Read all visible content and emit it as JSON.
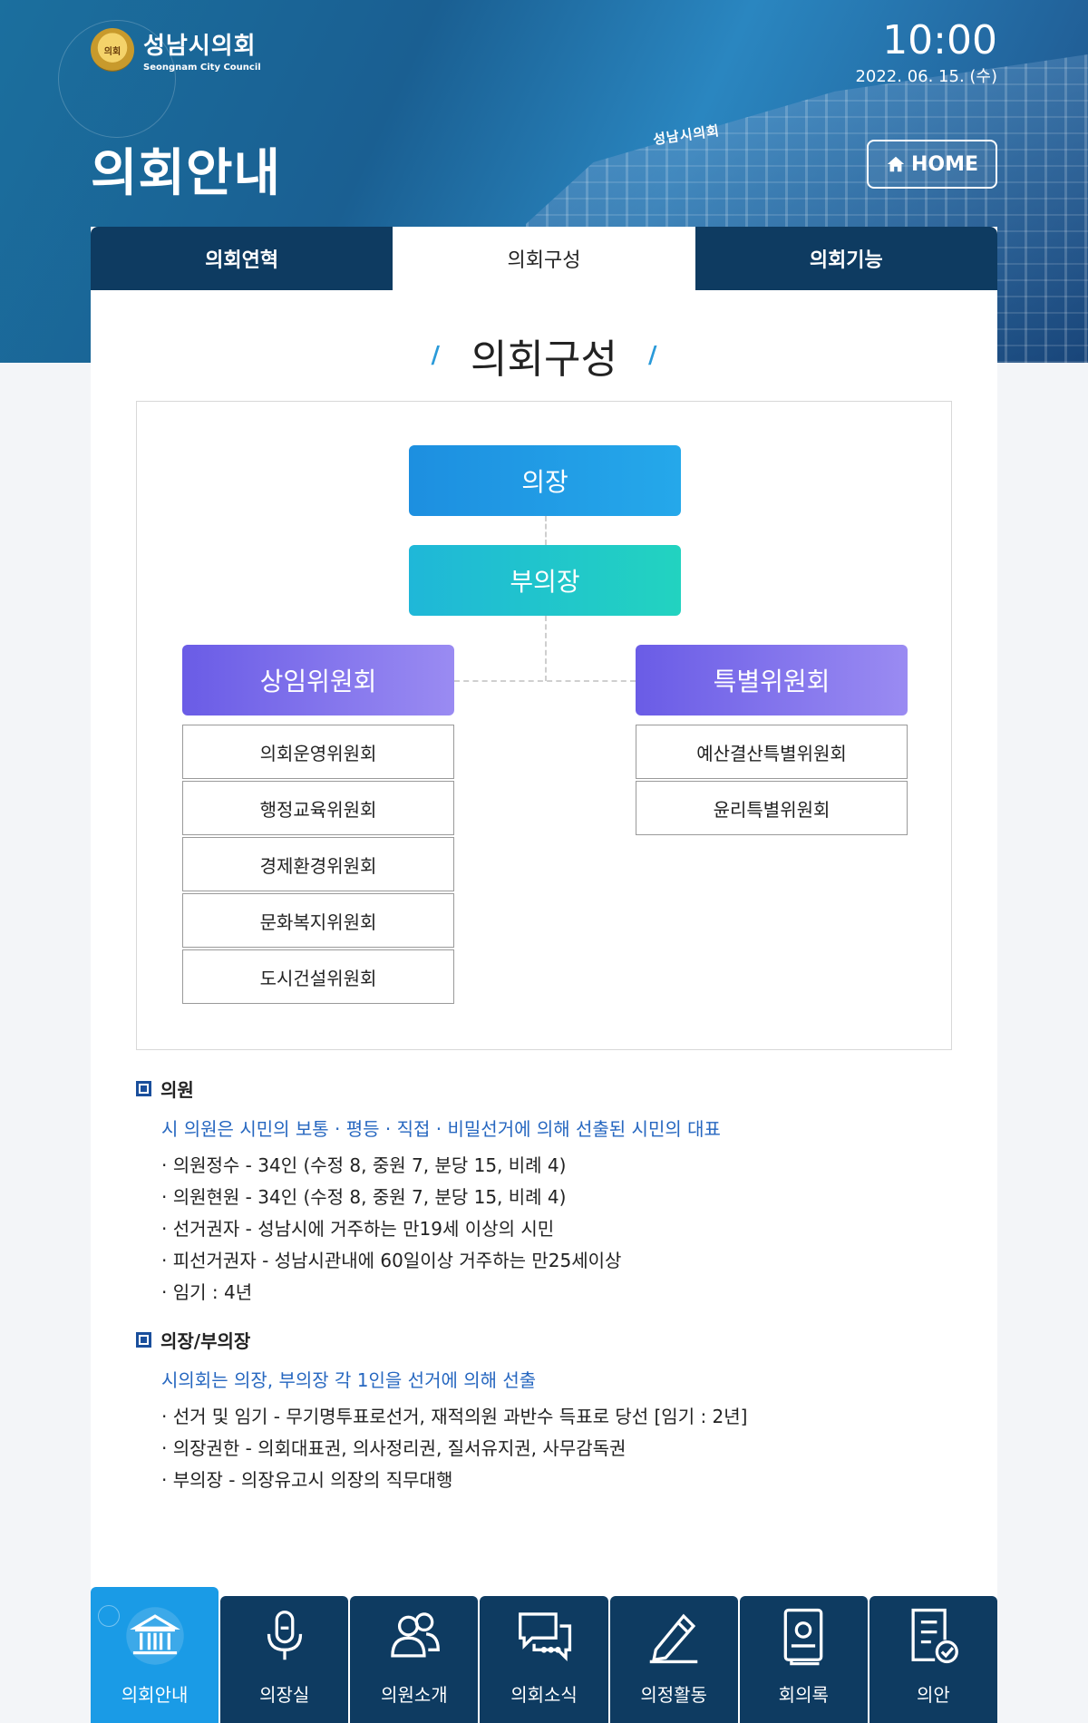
{
  "header": {
    "logo_ko": "성남시의회",
    "logo_en": "Seongnam City Council",
    "logo_mark": "의회",
    "building_sign": "성남시의회",
    "time": "10:00",
    "date": "2022. 06. 15. (수)",
    "page_title": "의회안내",
    "home_label": "HOME"
  },
  "tabs": [
    {
      "label": "의회연혁",
      "active": false
    },
    {
      "label": "의회구성",
      "active": true
    },
    {
      "label": "의회기능",
      "active": false
    }
  ],
  "section_title": "의회구성",
  "org": {
    "chair": "의장",
    "vice": "부의장",
    "standing": {
      "label": "상임위원회",
      "committees": [
        "의회운영위원회",
        "행정교육위원회",
        "경제환경위원회",
        "문화복지위원회",
        "도시건설위원회"
      ]
    },
    "special": {
      "label": "특별위원회",
      "committees": [
        "예산결산특별위원회",
        "윤리특별위원회"
      ]
    }
  },
  "info": {
    "members": {
      "heading": "의원",
      "lead": "시 의원은 시민의 보통 · 평등 · 직접 · 비밀선거에 의해 선출된 시민의 대표",
      "items": [
        "· 의원정수 - 34인 (수정 8, 중원 7, 분당 15, 비례 4)",
        "· 의원현원 - 34인 (수정 8, 중원 7, 분당 15, 비례 4)",
        "· 선거권자 - 성남시에 거주하는 만19세 이상의 시민",
        "· 피선거권자 - 성남시관내에 60일이상 거주하는 만25세이상",
        "· 임기 : 4년"
      ]
    },
    "chairs": {
      "heading": "의장/부의장",
      "lead": "시의회는 의장, 부의장 각 1인을 선거에 의해 선출",
      "items": [
        "· 선거 및 임기 - 무기명투표로선거, 재적의원 과반수 득표로 당선 [임기 : 2년]",
        "· 의장권한 - 의회대표권, 의사정리권, 질서유지권, 사무감독권",
        "· 부의장 - 의장유고시 의장의 직무대행"
      ]
    }
  },
  "bottom_nav": [
    {
      "label": "의회안내",
      "icon": "building-icon",
      "active": true
    },
    {
      "label": "의장실",
      "icon": "microphone-icon",
      "active": false
    },
    {
      "label": "의원소개",
      "icon": "people-icon",
      "active": false
    },
    {
      "label": "의회소식",
      "icon": "chat-icon",
      "active": false
    },
    {
      "label": "의정활동",
      "icon": "pencil-icon",
      "active": false
    },
    {
      "label": "회의록",
      "icon": "book-icon",
      "active": false
    },
    {
      "label": "의안",
      "icon": "document-check-icon",
      "active": false
    }
  ],
  "colors": {
    "navy": "#0e3b61",
    "active_blue": "#1a9be6",
    "lead_blue": "#2667c0",
    "committee_purple": "#7b6cec"
  }
}
